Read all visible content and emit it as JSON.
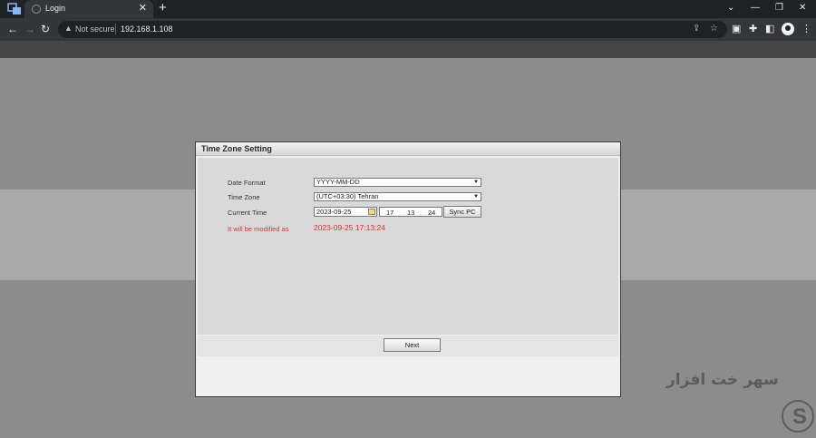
{
  "browser": {
    "tab_title": "Login",
    "tab_close": "✕",
    "new_tab": "+",
    "window_controls": {
      "dropdown": "⌄",
      "minimize": "—",
      "restore": "❐",
      "close": "✕"
    },
    "nav": {
      "back": "←",
      "forward": "→",
      "reload": "↻"
    },
    "security_label": "Not secure",
    "url": "192.168.1.108",
    "icons": [
      "share-icon",
      "star-icon",
      "extension-icon",
      "puzzle-icon",
      "sidepanel-icon",
      "profile-icon",
      "menu-icon"
    ],
    "menu": "⋮"
  },
  "dialog": {
    "title": "Time Zone Setting",
    "date_format_label": "Date Format",
    "date_format_value": "YYYY-MM-DD",
    "time_zone_label": "Time Zone",
    "time_zone_value": "(UTC+03:30) Tehran",
    "current_time_label": "Current Time",
    "current_date": "2023-09-25",
    "hour": "17",
    "minute": "13",
    "second": "24",
    "time_sep": ":",
    "sync_button": "Sync PC",
    "modified_label": "It will be modified as",
    "modified_value": "2023-09-25 17:13:24",
    "next_button": "Next"
  },
  "watermark": {
    "text": "سهر خت افزار",
    "logo_letter": "S"
  }
}
